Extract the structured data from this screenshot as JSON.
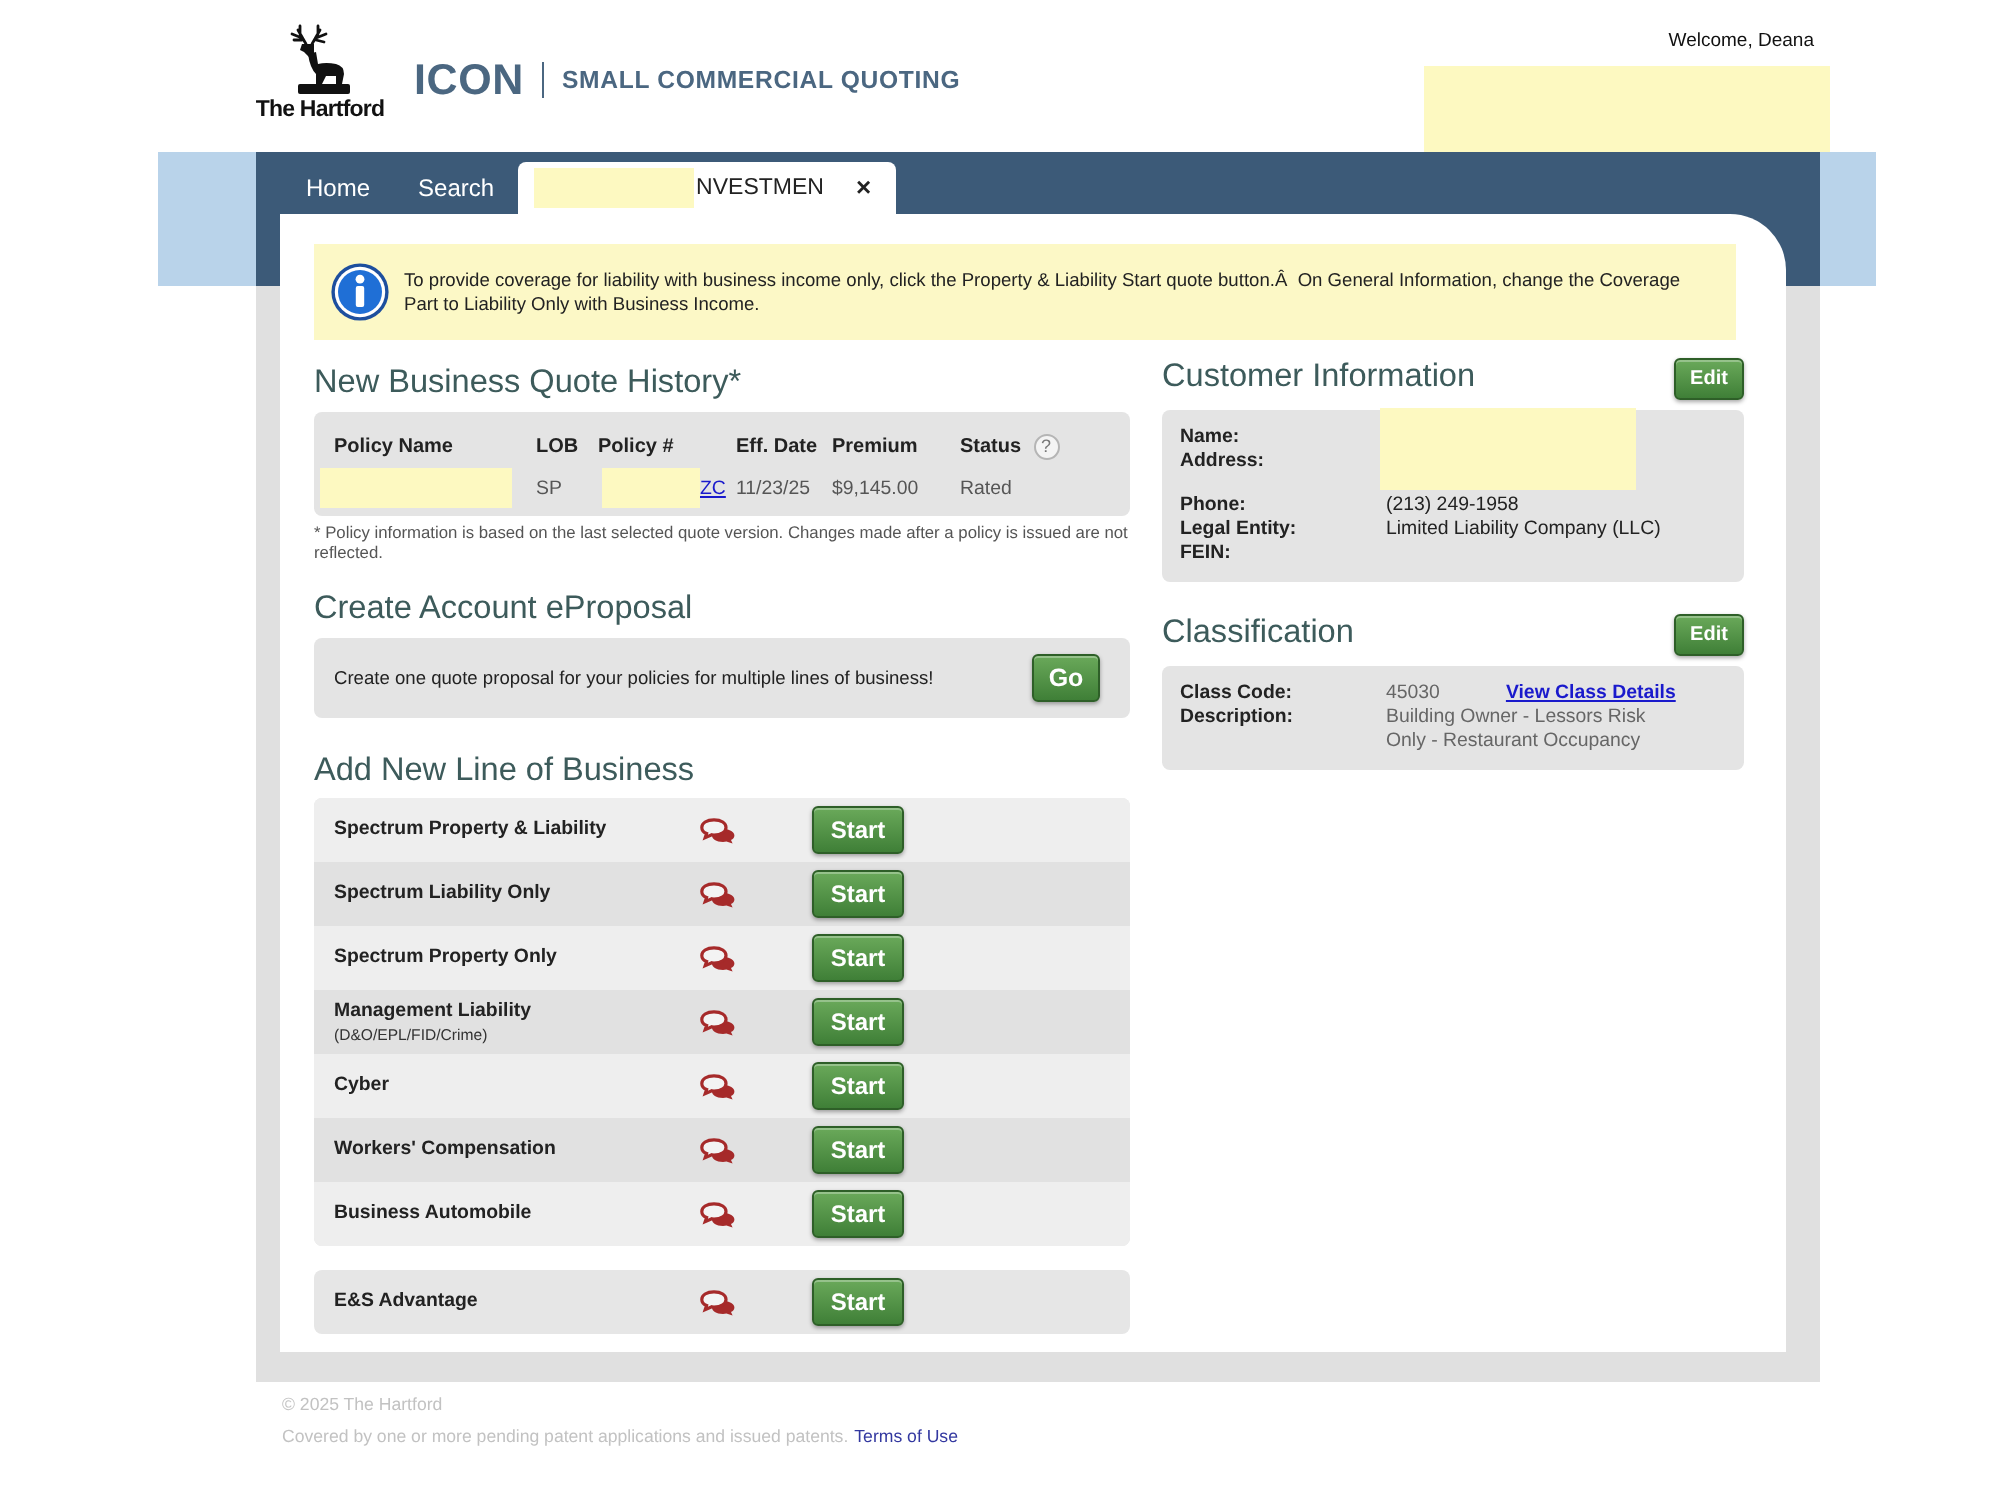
{
  "header": {
    "logo_text": "The Hartford",
    "app_name": "ICON",
    "app_subtitle": "SMALL COMMERCIAL QUOTING",
    "welcome": "Welcome, Deana",
    "account_redacted": true
  },
  "tabs": [
    {
      "label": "Home",
      "selected": false
    },
    {
      "label": "Search",
      "selected": false
    },
    {
      "label": "NVESTMEN",
      "selected": true,
      "redacted": true,
      "close": "×"
    }
  ],
  "notice": {
    "text": "To provide coverage for liability with business income only, click the Property & Liability Start quote button.Â  On General Information, change the Coverage Part to Liability Only with Business Income."
  },
  "quote_history": {
    "title": "New Business Quote History*",
    "columns": [
      {
        "label": "Policy Name"
      },
      {
        "label": "LOB"
      },
      {
        "label": "Policy #"
      },
      {
        "label": "Eff. Date"
      },
      {
        "label": "Premium"
      },
      {
        "label": "Status",
        "help": "?"
      }
    ],
    "rows": [
      {
        "cells": [
          {
            "redacted": true
          },
          {
            "text": "SP"
          },
          {
            "text": "ZC",
            "link": true,
            "redacted": true
          },
          {
            "text": "11/23/25"
          },
          {
            "text": "$9,145.00"
          },
          {
            "text": "Rated"
          }
        ]
      }
    ],
    "footnote": "* Policy information is based on the last selected quote version. Changes made after a policy is issued are not reflected."
  },
  "eproposal": {
    "title": "Create Account eProposal",
    "text": "Create one quote proposal for your policies for multiple lines of business!",
    "button": "Go"
  },
  "lines_of_business": {
    "title": "Add New Line of Business",
    "groups": [
      {
        "items": [
          {
            "name": "Spectrum Property & Liability",
            "button": "Start"
          },
          {
            "name": "Spectrum Liability Only",
            "button": "Start"
          },
          {
            "name": "Spectrum Property Only",
            "button": "Start"
          },
          {
            "name": "Management Liability",
            "sublabel": "(D&O/EPL/FID/Crime)",
            "button": "Start"
          },
          {
            "name": "Cyber",
            "button": "Start"
          },
          {
            "name": "Workers' Compensation",
            "button": "Start"
          },
          {
            "name": "Business Automobile",
            "button": "Start"
          }
        ]
      },
      {
        "items": [
          {
            "name": "E&S Advantage",
            "button": "Start"
          }
        ]
      }
    ]
  },
  "customer_information": {
    "title": "Customer Information",
    "button": "Edit",
    "field_groups": [
      {
        "redacted": true,
        "fields": [
          {
            "label": "Name:"
          },
          {
            "label": "Address:"
          }
        ]
      },
      {
        "fields": [
          {
            "label": "Phone:",
            "value": "(213) 249-1958"
          },
          {
            "label": "Legal Entity:",
            "value": "Limited Liability Company (LLC)"
          },
          {
            "label": "FEIN:"
          }
        ]
      }
    ]
  },
  "classification": {
    "title": "Classification",
    "button": "Edit",
    "field_groups": [
      {
        "fields": [
          {
            "label": "Class Code:",
            "value": "45030",
            "link": "View Class Details"
          },
          {
            "label": "Description:",
            "value": "Building Owner - Lessors Risk Only - Restaurant Occupancy"
          }
        ]
      }
    ]
  },
  "footer": {
    "copyright": "© 2025 The Hartford",
    "notice": "Covered by one or more pending patent applications and issued patents.",
    "link": "Terms of Use"
  }
}
